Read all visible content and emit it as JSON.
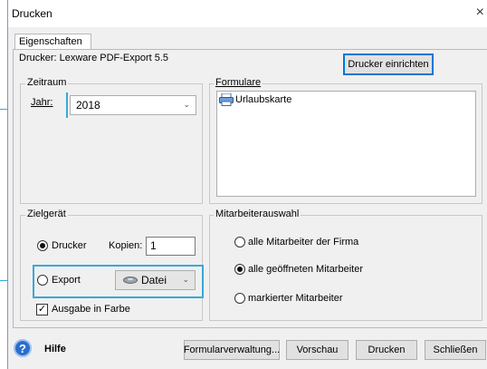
{
  "window": {
    "title": "Drucken",
    "close_symbol": "×"
  },
  "tab": {
    "label": "Eigenschaften"
  },
  "printer": {
    "label": "Drucker: Lexware PDF-Export 5.5",
    "setup_button": "Drucker einrichten"
  },
  "zeitraum": {
    "group_label": "Zeitraum",
    "year_label": "Jahr:",
    "year_value": "2018"
  },
  "formulare": {
    "group_label": "Formulare",
    "items": [
      {
        "label": "Urlaubskarte",
        "icon": "printer-icon"
      }
    ]
  },
  "zielgeraet": {
    "group_label": "Zielgerät",
    "drucker_label": "Drucker",
    "drucker_checked": true,
    "kopien_label": "Kopien:",
    "kopien_value": "1",
    "export_label": "Export",
    "export_checked": false,
    "export_target": "Datei",
    "export_icon": "disk-icon",
    "farbe_label": "Ausgabe in Farbe",
    "farbe_checked": true
  },
  "mitarbeiter": {
    "group_label": "Mitarbeiterauswahl",
    "options": [
      {
        "label": "alle Mitarbeiter der Firma",
        "checked": false
      },
      {
        "label": "alle geöffneten Mitarbeiter",
        "checked": true
      },
      {
        "label": "markierter Mitarbeiter",
        "checked": false
      }
    ]
  },
  "footer": {
    "help_label": "Hilfe",
    "help_icon": "question-icon",
    "buttons": {
      "formularverwaltung": "Formularverwaltung...",
      "vorschau": "Vorschau",
      "drucken": "Drucken",
      "schliessen": "Schließen"
    }
  },
  "colors": {
    "callout": "#3aa8d8",
    "help_icon": "#2a6ecb",
    "default_button_border": "#0078d7"
  }
}
